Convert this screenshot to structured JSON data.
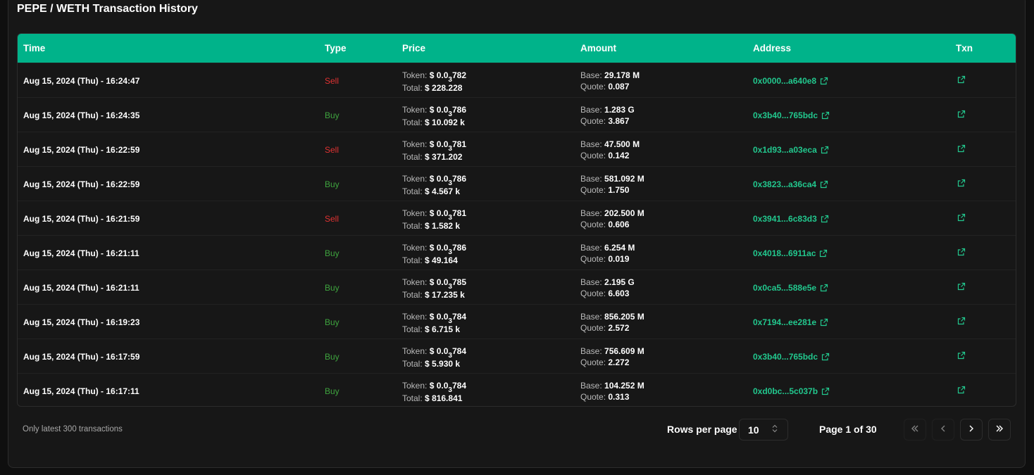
{
  "title": "PEPE / WETH Transaction History",
  "columns": {
    "time": "Time",
    "type": "Type",
    "price": "Price",
    "amount": "Amount",
    "address": "Address",
    "txn": "Txn"
  },
  "labels": {
    "token": "Token:",
    "total": "Total:",
    "base": "Base:",
    "quote": "Quote:"
  },
  "rows": [
    {
      "time": "Aug 15, 2024 (Thu) - 16:24:47",
      "type": "Sell",
      "token_prefix": "$ 0.0",
      "token_sub": "3",
      "token_rest": "782",
      "total": "$ 228.228",
      "base": "29.178 M",
      "quote": "0.087",
      "address": "0x0000...a640e8"
    },
    {
      "time": "Aug 15, 2024 (Thu) - 16:24:35",
      "type": "Buy",
      "token_prefix": "$ 0.0",
      "token_sub": "3",
      "token_rest": "786",
      "total": "$ 10.092 k",
      "base": "1.283 G",
      "quote": "3.867",
      "address": "0x3b40...765bdc"
    },
    {
      "time": "Aug 15, 2024 (Thu) - 16:22:59",
      "type": "Sell",
      "token_prefix": "$ 0.0",
      "token_sub": "3",
      "token_rest": "781",
      "total": "$ 371.202",
      "base": "47.500 M",
      "quote": "0.142",
      "address": "0x1d93...a03eca"
    },
    {
      "time": "Aug 15, 2024 (Thu) - 16:22:59",
      "type": "Buy",
      "token_prefix": "$ 0.0",
      "token_sub": "3",
      "token_rest": "786",
      "total": "$ 4.567 k",
      "base": "581.092 M",
      "quote": "1.750",
      "address": "0x3823...a36ca4"
    },
    {
      "time": "Aug 15, 2024 (Thu) - 16:21:59",
      "type": "Sell",
      "token_prefix": "$ 0.0",
      "token_sub": "3",
      "token_rest": "781",
      "total": "$ 1.582 k",
      "base": "202.500 M",
      "quote": "0.606",
      "address": "0x3941...6c83d3"
    },
    {
      "time": "Aug 15, 2024 (Thu) - 16:21:11",
      "type": "Buy",
      "token_prefix": "$ 0.0",
      "token_sub": "3",
      "token_rest": "786",
      "total": "$ 49.164",
      "base": "6.254 M",
      "quote": "0.019",
      "address": "0x4018...6911ac"
    },
    {
      "time": "Aug 15, 2024 (Thu) - 16:21:11",
      "type": "Buy",
      "token_prefix": "$ 0.0",
      "token_sub": "3",
      "token_rest": "785",
      "total": "$ 17.235 k",
      "base": "2.195 G",
      "quote": "6.603",
      "address": "0x0ca5...588e5e"
    },
    {
      "time": "Aug 15, 2024 (Thu) - 16:19:23",
      "type": "Buy",
      "token_prefix": "$ 0.0",
      "token_sub": "3",
      "token_rest": "784",
      "total": "$ 6.715 k",
      "base": "856.205 M",
      "quote": "2.572",
      "address": "0x7194...ee281e"
    },
    {
      "time": "Aug 15, 2024 (Thu) - 16:17:59",
      "type": "Buy",
      "token_prefix": "$ 0.0",
      "token_sub": "3",
      "token_rest": "784",
      "total": "$ 5.930 k",
      "base": "756.609 M",
      "quote": "2.272",
      "address": "0x3b40...765bdc"
    },
    {
      "time": "Aug 15, 2024 (Thu) - 16:17:11",
      "type": "Buy",
      "token_prefix": "$ 0.0",
      "token_sub": "3",
      "token_rest": "784",
      "total": "$ 816.841",
      "base": "104.252 M",
      "quote": "0.313",
      "address": "0xd0bc...5c037b"
    }
  ],
  "footer": {
    "note": "Only latest 300 transactions",
    "rows_per_page_label": "Rows per page",
    "rows_per_page_value": "10",
    "page_info": "Page 1 of 30"
  },
  "icons": {
    "external_link": "external-link-icon",
    "first_page": "chevrons-left-icon",
    "prev_page": "chevron-left-icon",
    "next_page": "chevron-right-icon",
    "last_page": "chevrons-right-icon",
    "select": "chevron-up-down-icon"
  },
  "colors": {
    "header": "#00b38a",
    "sell": "#e03232",
    "buy": "#3ea33e",
    "address": "#22c88e"
  }
}
